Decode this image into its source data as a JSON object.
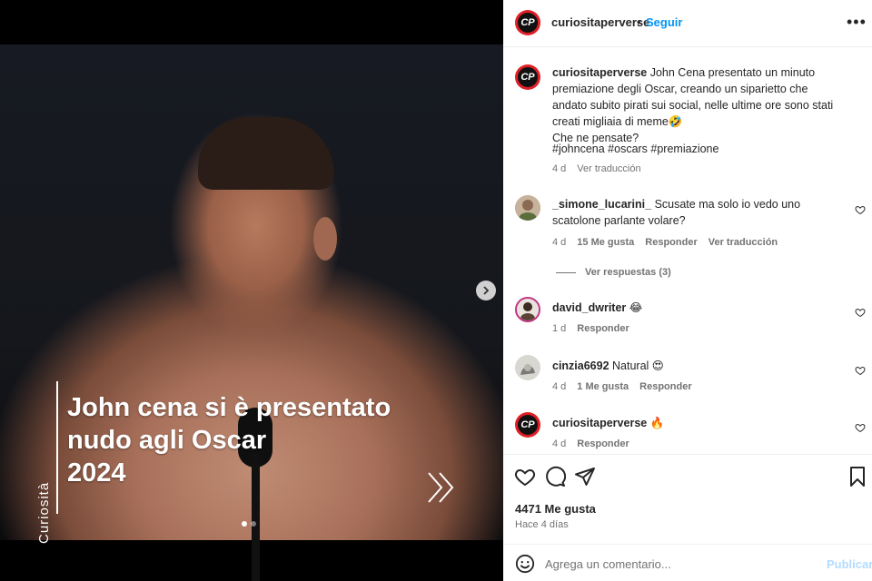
{
  "post": {
    "username": "curiositaperverse",
    "separator": "•",
    "follow_label": "Seguir",
    "more_label": "•••",
    "avatar_initials": "CP"
  },
  "media": {
    "overlay_side_label": "Curiosità",
    "overlay_title": "John cena si  è presentato\nnudo agli Oscar\n2024",
    "slide_count": 2,
    "active_slide": 1
  },
  "caption": {
    "username": "curiositaperverse",
    "text": "John Cena presentato un minuto premiazione degli Oscar, creando un siparietto che andato subito pirati sui social, nelle ultime ore sono stati creati migliaia di meme🤣",
    "line2": "Che ne pensate?",
    "hashtags": "#johncena #oscars #premiazione",
    "time": "4 d",
    "translate": "Ver traducción"
  },
  "comments": [
    {
      "username": "_simone_lucarini_",
      "text": "Scusate ma solo io vedo uno scatolone parlante volare?",
      "time": "4 d",
      "likes": "15 Me gusta",
      "reply": "Responder",
      "translate": "Ver traducción",
      "view_replies": "Ver respuestas (3)"
    },
    {
      "username": "david_dwriter",
      "text": "😂",
      "time": "1 d",
      "reply": "Responder"
    },
    {
      "username": "cinzia6692",
      "text": "Natural 😍",
      "time": "4 d",
      "likes": "1 Me gusta",
      "reply": "Responder"
    },
    {
      "username": "curiositaperverse",
      "text": "🔥",
      "time": "4 d",
      "reply": "Responder"
    }
  ],
  "footer": {
    "likes": "4471 Me gusta",
    "ago": "Hace 4 días",
    "comment_placeholder": "Agrega un comentario...",
    "publish_label": "Publicar"
  },
  "colors": {
    "brand_red": "#e01f26",
    "link_blue": "#0095f6",
    "hashtag": "#00376b",
    "publish_disabled": "#b3dbff"
  }
}
